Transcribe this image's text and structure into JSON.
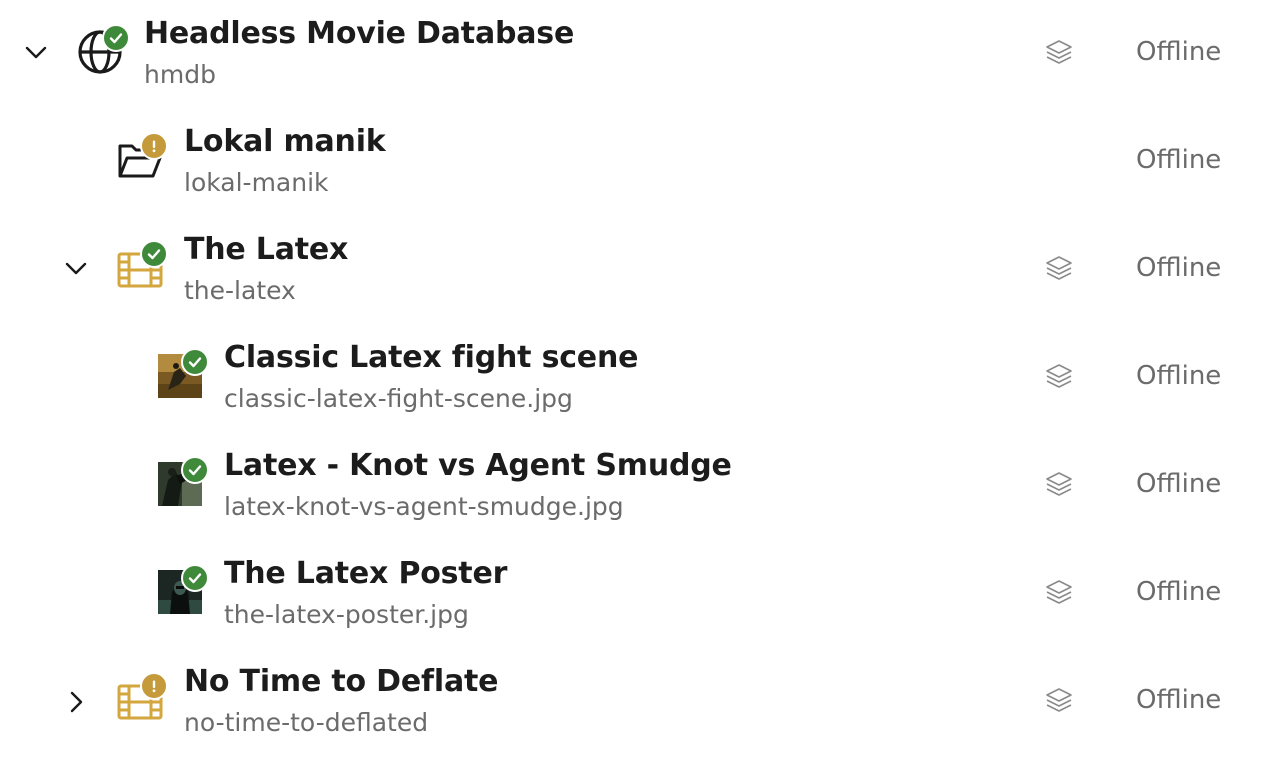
{
  "rows": [
    {
      "title": "Headless Movie Database",
      "slug": "hmdb",
      "status": "Offline",
      "icon": "globe-icon",
      "badge": "check",
      "expand": "expanded"
    },
    {
      "title": "Lokal manik",
      "slug": "lokal-manik",
      "status": "Offline",
      "icon": "folder-open-icon",
      "badge": "warning"
    },
    {
      "title": "The Latex",
      "slug": "the-latex",
      "status": "Offline",
      "icon": "film-icon",
      "badge": "check",
      "expand": "expanded"
    },
    {
      "title": "Classic Latex fight scene",
      "slug": "classic-latex-fight-scene.jpg",
      "status": "Offline",
      "icon": "image-thumbnail",
      "badge": "check"
    },
    {
      "title": "Latex - Knot vs Agent Smudge",
      "slug": "latex-knot-vs-agent-smudge.jpg",
      "status": "Offline",
      "icon": "image-thumbnail",
      "badge": "check"
    },
    {
      "title": "The Latex Poster",
      "slug": "the-latex-poster.jpg",
      "status": "Offline",
      "icon": "image-thumbnail",
      "badge": "check"
    },
    {
      "title": "No Time to Deflate",
      "slug": "no-time-to-deflated",
      "status": "Offline",
      "icon": "film-icon",
      "badge": "warning",
      "expand": "collapsed"
    }
  ],
  "colors": {
    "ok": "#3f8a3a",
    "warning": "#c49a3a",
    "film": "#d4a63e",
    "muted": "#6b6b6b"
  }
}
